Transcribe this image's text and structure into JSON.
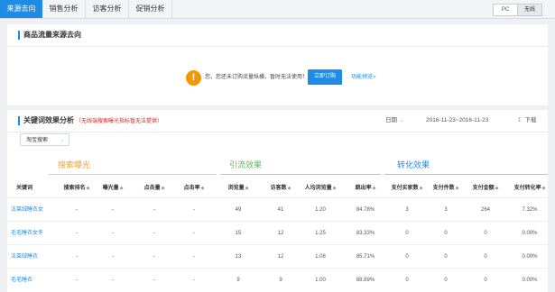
{
  "tabs": [
    "来源去向",
    "销售分析",
    "访客分析",
    "促销分析"
  ],
  "device_toggle": {
    "pc": "PC",
    "wireless": "无线",
    "selected": "无线"
  },
  "source_panel": {
    "title": "商品流量来源去向",
    "notice_icon": "!",
    "notice_text": "您，您还未订购流量纵横，暂时无法使用！",
    "subscribe_button": "立即订购",
    "preview_link": "功能预览>"
  },
  "keyword_panel": {
    "title": "关键词效果分析",
    "note": "（无线端搜索曝光指标暂无法提供）",
    "date_label": "日期",
    "date_range": "2016-11-23~2016-11-23",
    "download": "下载",
    "select_value": "淘宝搜索",
    "groups": {
      "search": "搜索曝光",
      "traffic": "引流效果",
      "conversion": "转化效果"
    },
    "keyword_header": "关键词",
    "columns": [
      "搜索排名",
      "曝光量",
      "点击量",
      "点击率",
      "浏览量",
      "访客数",
      "人均浏览量",
      "跳出率",
      "支付买家数",
      "支付件数",
      "支付金额",
      "支付转化率"
    ],
    "rows": [
      {
        "keyword": "法莱绒睡衣女",
        "values": [
          "-",
          "-",
          "-",
          "-",
          "49",
          "41",
          "1.20",
          "84.78%",
          "3",
          "3",
          "264",
          "7.32%"
        ]
      },
      {
        "keyword": "毛毛睡衣女冬",
        "values": [
          "-",
          "-",
          "-",
          "-",
          "15",
          "12",
          "1.25",
          "83.33%",
          "0",
          "0",
          "0",
          "0.00%"
        ]
      },
      {
        "keyword": "法莱绒睡衣",
        "values": [
          "-",
          "-",
          "-",
          "-",
          "13",
          "12",
          "1.08",
          "85.71%",
          "0",
          "0",
          "0",
          "0.00%"
        ]
      },
      {
        "keyword": "毛毛睡衣",
        "values": [
          "-",
          "-",
          "-",
          "-",
          "9",
          "9",
          "1.00",
          "88.89%",
          "0",
          "0",
          "0",
          "0.00%"
        ]
      }
    ]
  },
  "colors": {
    "accent": "#1e8ce6",
    "warning": "#f39800",
    "search_group": "#f0a030",
    "traffic_group": "#5cb85c",
    "conversion_group": "#1e8ce6",
    "note": "#e02020"
  }
}
